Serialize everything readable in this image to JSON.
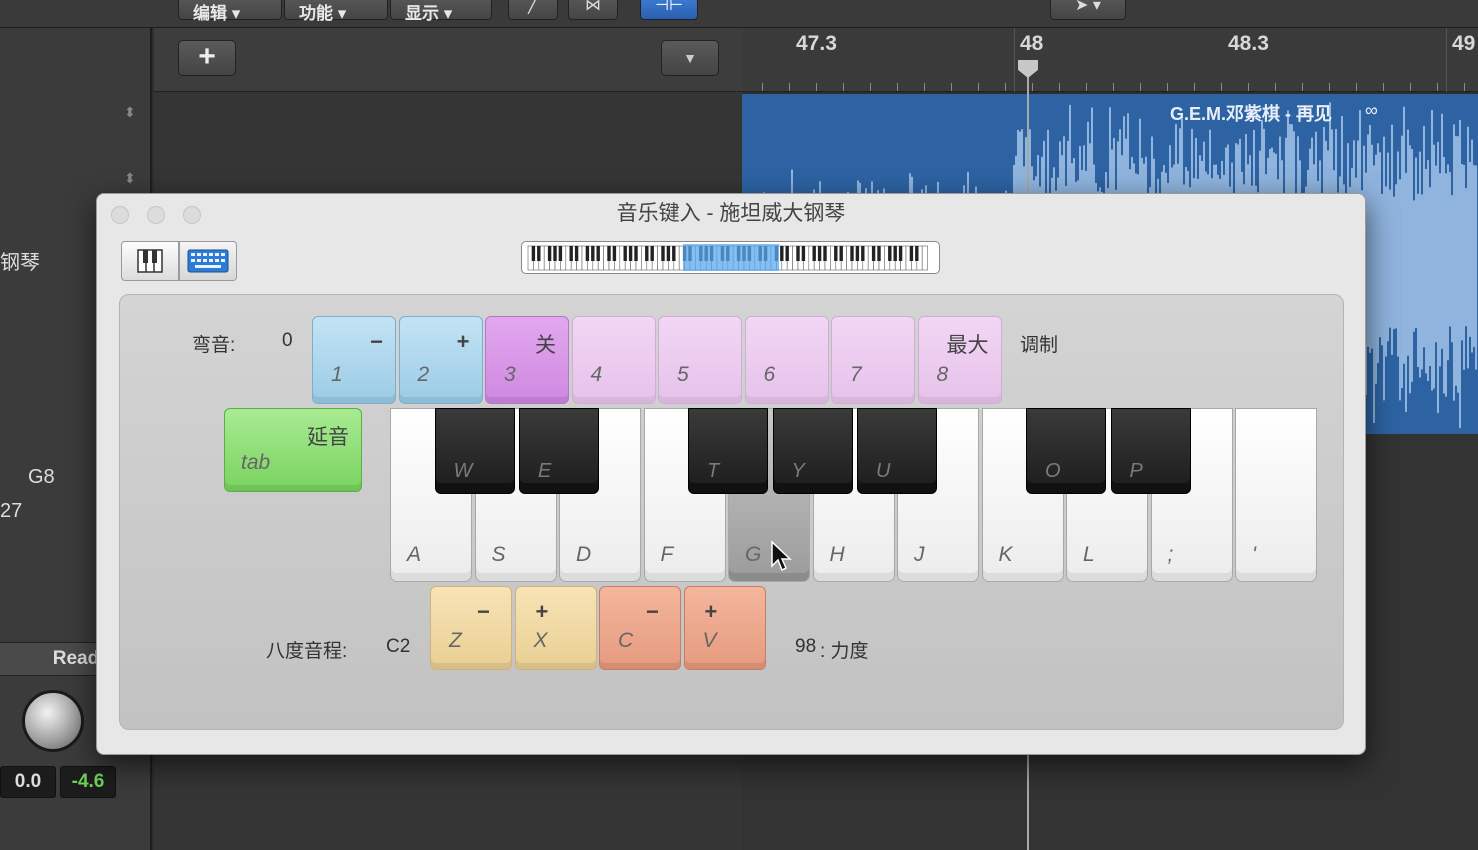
{
  "toolbar": {
    "menus": [
      "编辑",
      "功能",
      "显示"
    ],
    "add_label": "+",
    "dropdown_label": "▼"
  },
  "ruler": {
    "marks": [
      "47.3",
      "48",
      "48.3",
      "49"
    ]
  },
  "region": {
    "title": "G.E.M.邓紫棋 - 再见",
    "loop_symbol": "∞"
  },
  "left_strip": {
    "instrument_fragment": "钢琴",
    "note": "G8",
    "number": "27",
    "automation": "Read",
    "volume": "0.0",
    "peak": "-4.6",
    "colors": {
      "peak": "#6fd35a"
    }
  },
  "window": {
    "title": "音乐键入 - 施坦威大钢琴",
    "mode_buttons": [
      "piano-mode",
      "keyboard-mode"
    ]
  },
  "controls": {
    "pitch_bend_label": "弯音:",
    "pitch_bend_value": "0",
    "modulation_label": "调制",
    "octave_label": "八度音程:",
    "octave_value": "C2",
    "velocity_value": "98",
    "velocity_label": ":  力度"
  },
  "number_keys": [
    {
      "top": "−",
      "bottom": "1"
    },
    {
      "top": "+",
      "bottom": "2"
    },
    {
      "top": "关",
      "bottom": "3"
    },
    {
      "top": "",
      "bottom": "4"
    },
    {
      "top": "",
      "bottom": "5"
    },
    {
      "top": "",
      "bottom": "6"
    },
    {
      "top": "",
      "bottom": "7"
    },
    {
      "top": "最大",
      "bottom": "8"
    }
  ],
  "sustain_key": {
    "top": "延音",
    "bottom": "tab"
  },
  "white_keys": [
    "A",
    "S",
    "D",
    "F",
    "G",
    "H",
    "J",
    "K",
    "L",
    ";",
    "'"
  ],
  "black_keys": [
    "W",
    "E",
    "T",
    "Y",
    "U",
    "O",
    "P"
  ],
  "pressed_key": "G",
  "octave_keys": [
    {
      "top": "−",
      "bottom": "Z"
    },
    {
      "top": "+",
      "bottom": "X"
    },
    {
      "top": "−",
      "bottom": "C"
    },
    {
      "top": "+",
      "bottom": "V"
    }
  ]
}
